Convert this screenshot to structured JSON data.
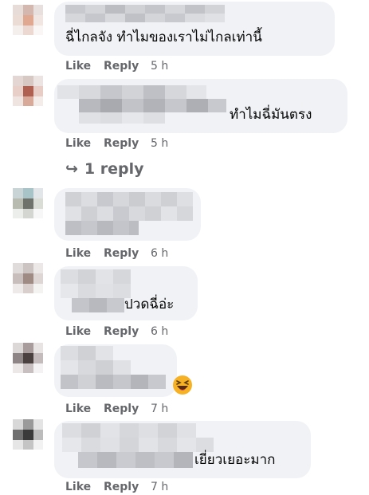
{
  "comments": [
    {
      "text": "ฉี่ไกลจัง ทำไมของเราไม่ไกลเท่านี้",
      "like": "Like",
      "reply": "Reply",
      "time": "5 h"
    },
    {
      "text": "ทำไมฉี่มันตรง",
      "like": "Like",
      "reply": "Reply",
      "time": "5 h"
    },
    {
      "text": "",
      "like": "Like",
      "reply": "Reply",
      "time": "6 h"
    },
    {
      "text": "ปวดฉี่อ่ะ",
      "like": "Like",
      "reply": "Reply",
      "time": "6 h"
    },
    {
      "text": "",
      "like": "Like",
      "reply": "Reply",
      "time": "7 h",
      "emoji": "laughing-squinting-face"
    },
    {
      "text": "เยี่ยวเยอะมาก",
      "like": "Like",
      "reply": "Reply",
      "time": "7 h"
    }
  ],
  "replies_link": {
    "icon": "reply-arrow",
    "label": "1 reply"
  },
  "colors": {
    "bubble": "#f0f2f5",
    "meta": "#65676b",
    "text": "#050505",
    "emoji": "#f7b125"
  }
}
